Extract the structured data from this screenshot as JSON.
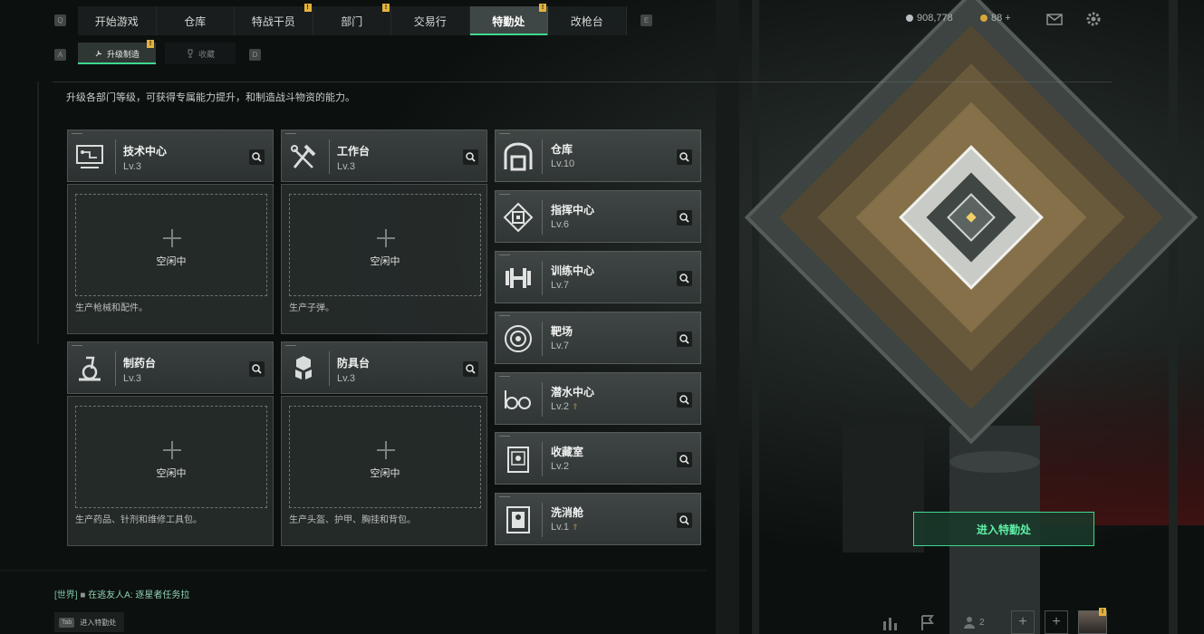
{
  "nav": {
    "tabs": [
      {
        "label": "开始游戏"
      },
      {
        "label": "仓库"
      },
      {
        "label": "特战干员",
        "badge": "!"
      },
      {
        "label": "部门",
        "badge": "!"
      },
      {
        "label": "交易行"
      },
      {
        "label": "特勤处",
        "badge": "!",
        "active": true
      },
      {
        "label": "改枪台"
      }
    ],
    "left_key": "Q",
    "right_key": "E"
  },
  "subtabs": {
    "left_key": "A",
    "right_key": "D",
    "items": [
      {
        "label": "升级制造",
        "badge": "!",
        "icon": "wrench-icon",
        "active": true
      },
      {
        "label": "收藏",
        "icon": "trophy-icon"
      }
    ]
  },
  "resources": [
    {
      "value": "908,778",
      "icon": "silver-coin-icon",
      "color": "#b8bec2"
    },
    {
      "value": "88 +",
      "icon": "gold-coin-icon",
      "color": "#d6a83a"
    }
  ],
  "description": "升级各部门等级，可获得专属能力提升，和制造战斗物资的能力。",
  "workshops": [
    {
      "name": "技术中心",
      "level": "Lv.3",
      "status": "空闲中",
      "desc": "生产枪械和配件。",
      "icon": "tech-center-icon"
    },
    {
      "name": "工作台",
      "level": "Lv.3",
      "status": "空闲中",
      "desc": "生产子弹。",
      "icon": "workbench-icon"
    },
    {
      "name": "制药台",
      "level": "Lv.3",
      "status": "空闲中",
      "desc": "生产药品、针剂和维修工具包。",
      "icon": "pharmacy-icon"
    },
    {
      "name": "防具台",
      "level": "Lv.3",
      "status": "空闲中",
      "desc": "生产头盔、护甲、胸挂和背包。",
      "icon": "armory-icon"
    }
  ],
  "facilities": [
    {
      "name": "仓库",
      "level": "Lv.10",
      "icon": "warehouse-icon"
    },
    {
      "name": "指挥中心",
      "level": "Lv.6",
      "icon": "command-center-icon"
    },
    {
      "name": "训练中心",
      "level": "Lv.7",
      "icon": "dumbbell-icon"
    },
    {
      "name": "靶场",
      "level": "Lv.7",
      "icon": "target-icon"
    },
    {
      "name": "潜水中心",
      "level": "Lv.2",
      "upgradeable": true,
      "icon": "diving-goggles-icon"
    },
    {
      "name": "收藏室",
      "level": "Lv.2",
      "icon": "collection-room-icon"
    },
    {
      "name": "洗消舱",
      "level": "Lv.1",
      "upgradeable": true,
      "icon": "decontamination-icon"
    }
  ],
  "enter_button": "进入特勤处",
  "chat": {
    "channel": "[世界]",
    "message": "在逃友人A: 逐星者任务拉"
  },
  "tab_hint": {
    "key": "Tab",
    "label": "进入特勤处"
  },
  "bottom_bar": {
    "friends_count": "2"
  },
  "colors": {
    "accent": "#3fd88f",
    "badge": "#e2b23c",
    "upgrade": "#a8894a"
  }
}
